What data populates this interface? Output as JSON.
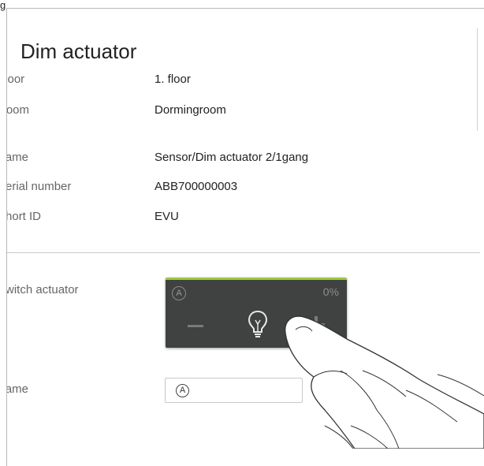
{
  "figure_caption": "g",
  "page": {
    "title": "Dim actuator",
    "info": [
      {
        "label": "Floor",
        "value": "1. floor"
      },
      {
        "label": "Room",
        "value": "Dormingroom"
      }
    ],
    "device": [
      {
        "label": "Name",
        "value": "Sensor/Dim actuator 2/1gang"
      },
      {
        "label": "Serial number",
        "value": "ABB700000003"
      },
      {
        "label": "Short ID",
        "value": "EVU"
      }
    ],
    "switch_actuator": {
      "label": "Switch actuator",
      "auto_symbol": "A",
      "percent_label": "0%",
      "brightness_level": 0,
      "accent_color": "#9dc93b",
      "tile_color": "#3f4240",
      "icons": [
        "minus-icon",
        "bulb-icon",
        "plus-icon"
      ]
    },
    "name_field": {
      "label": "Name",
      "auto_symbol": "A",
      "value": ""
    }
  }
}
